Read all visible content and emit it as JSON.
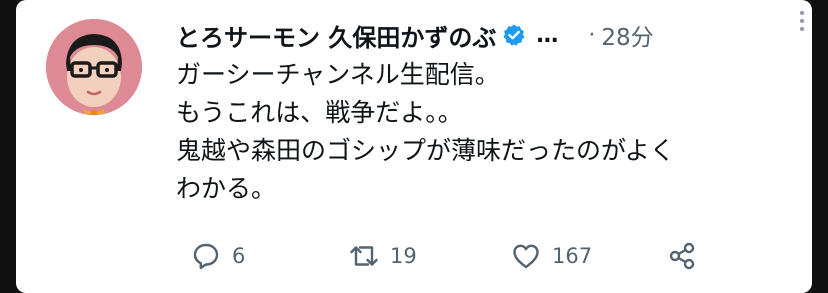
{
  "tweet": {
    "display_name": "とろサーモン 久保田かずのぶ",
    "ellipsis": "…",
    "separator": "·",
    "time": "28分",
    "text_lines": [
      "ガーシーチャンネル生配信。",
      "もうこれは、戦争だよ。。",
      "鬼越や森田のゴシップが薄味だったのがよく",
      "わかる。"
    ]
  },
  "actions": {
    "reply_count": "6",
    "retweet_count": "19",
    "like_count": "167"
  },
  "icons": {
    "verified": "verified-badge-icon",
    "more": "more-vertical-icon",
    "reply": "reply-icon",
    "retweet": "retweet-icon",
    "like": "heart-icon",
    "share": "share-icon"
  },
  "colors": {
    "verified_blue": "#1d9bf0",
    "muted_text": "#536471",
    "avatar_bg": "#dd8a94"
  }
}
